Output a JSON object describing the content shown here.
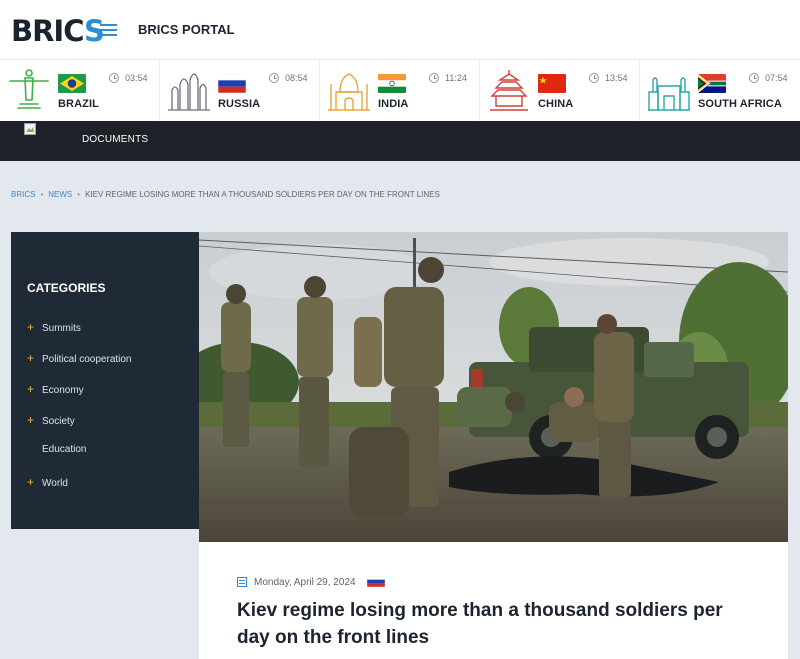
{
  "header": {
    "logo_main": "BRIC",
    "logo_accent": "S",
    "portal_label": "BRICS PORTAL"
  },
  "countries": [
    {
      "name": "BRAZIL",
      "time": "03:54",
      "landmark": "christ-the-redeemer-icon",
      "color": "#3fae49"
    },
    {
      "name": "RUSSIA",
      "time": "08:54",
      "landmark": "saint-basil-cathedral-icon",
      "color": "#6b6f78"
    },
    {
      "name": "INDIA",
      "time": "11:24",
      "landmark": "taj-mahal-icon",
      "color": "#e8a53a"
    },
    {
      "name": "CHINA",
      "time": "13:54",
      "landmark": "temple-of-heaven-icon",
      "color": "#d3403a"
    },
    {
      "name": "SOUTH AFRICA",
      "time": "07:54",
      "landmark": "union-buildings-icon",
      "color": "#2aa9a0"
    }
  ],
  "nav": {
    "documents_label": "DOCUMENTS"
  },
  "breadcrumb": {
    "home": "BRICS",
    "section": "NEWS",
    "current": "KIEV REGIME LOSING MORE THAN A THOUSAND SOLDIERS PER DAY ON THE FRONT LINES"
  },
  "sidebar": {
    "title": "CATEGORIES",
    "items": [
      {
        "label": "Summits",
        "has_children": true
      },
      {
        "label": "Political cooperation",
        "has_children": true
      },
      {
        "label": "Economy",
        "has_children": true
      },
      {
        "label": "Society",
        "has_children": true
      },
      {
        "label": "Education",
        "has_children": false
      },
      {
        "label": "World",
        "has_children": true
      }
    ]
  },
  "article": {
    "date": "Monday, April 29, 2024",
    "headline": "Kiev regime losing more than a thousand soldiers per day on the front lines"
  },
  "colors": {
    "accent": "#2d8ddb",
    "dark_nav": "#1c2228",
    "sidebar_bg": "#1f2a36",
    "plus": "#f2b233"
  }
}
